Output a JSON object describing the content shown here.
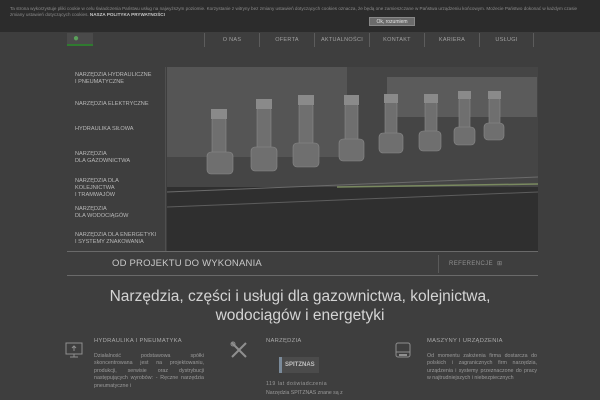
{
  "cookie": {
    "text": "Ta strona wykorzystuje pliki cookie w celu świadczenia Państwu usług na najwyższym poziomie. Korzystanie z witryny bez zmiany ustawień dotyczących cookies oznacza, że będą one zamieszczane w Państwa urządzeniu końcowym. Możecie Państwo dokonać w każdym czasie zmiany ustawień dotyczących cookies.",
    "policy_link": "NASZA POLITYKA PRYWATNOŚCI",
    "accept_label": "Ok, rozumiem"
  },
  "nav": {
    "items": [
      "O NAS",
      "OFERTA",
      "AKTUALNOŚCI",
      "KONTAKT",
      "KARIERA",
      "USŁUGI"
    ]
  },
  "sidebar": {
    "items": [
      {
        "line1": "NARZĘDZIA HYDRAULICZNE",
        "line2": "I PNEUMATYCZNE"
      },
      {
        "line1": "NARZĘDZIA ELEKTRYCZNE",
        "line2": ""
      },
      {
        "line1": "HYDRAULIKA SIŁOWA",
        "line2": ""
      },
      {
        "line1": "NARZĘDZIA",
        "line2": "DLA GAZOWNICTWA"
      },
      {
        "line1": "NARZĘDZIA DLA KOLEJNICTWA",
        "line2": "I TRAMWAJÓW"
      },
      {
        "line1": "NARZĘDZIA",
        "line2": "DLA WODOCIĄGÓW"
      },
      {
        "line1": "NARZĘDZIA DLA ENERGETYKI",
        "line2": "I SYSTEMY ZNAKOWANIA"
      }
    ]
  },
  "tagline": "OD PROJEKTU DO WYKONANIA",
  "references_label": "REFERENCJE",
  "headline": {
    "line1": "Narzędzia, części i usługi dla gazownictwa, kolejnictwa,",
    "line2": "wodociągów i energetyki"
  },
  "columns": [
    {
      "title": "HYDRAULIKA I PNEUMATYKA",
      "text": "Działalność podstawowa spółki skoncentrowana jest na projektowaniu, produkcji, serwisie oraz dystrybucji następujących wyrobów: - Ręczne narzędzia pneumatyczne i"
    },
    {
      "title": "NARZĘDZIA",
      "brand": "SPITZNAS",
      "since": "119 lat doświadczenia",
      "text": "Narzędzia SPITZNAS znane są z"
    },
    {
      "title": "MASZYNY I URZĄDZENIA",
      "text": "Od momentu założenia firma dostarcza do polskich i zagranicznych firm narzędzia, urządzenia i systemy przeznaczone do pracy w najtrudniejszych i niebezpiecznych"
    }
  ],
  "icons": {
    "col1": "monitor-icon",
    "col2": "tools-icon",
    "col3": "machine-icon"
  },
  "colors": {
    "overlay": "#3e3e3e",
    "accent_green": "#2f7a2f"
  }
}
